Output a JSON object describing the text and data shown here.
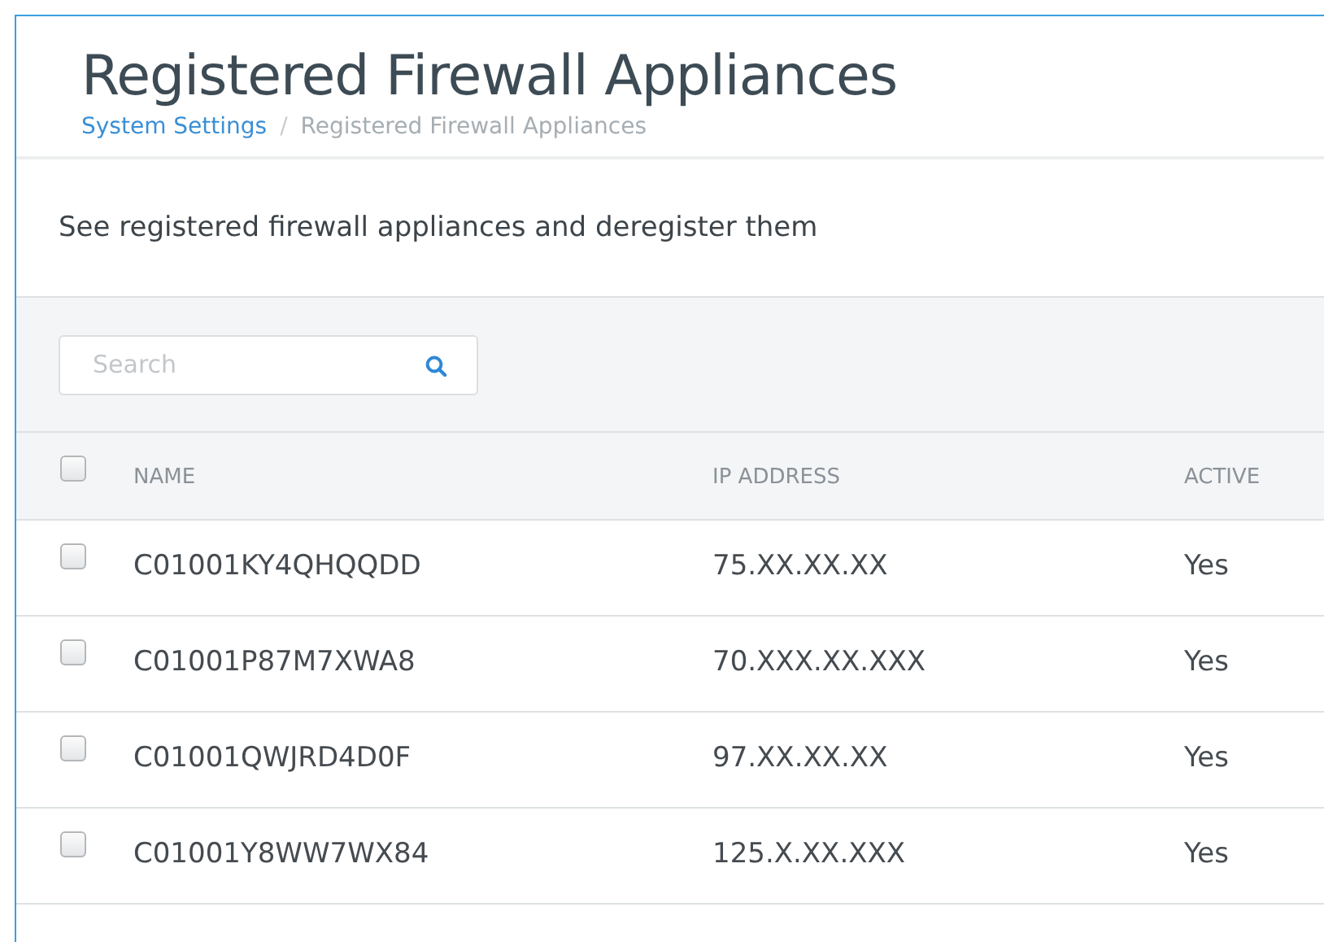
{
  "page": {
    "title": "Registered Firewall Appliances",
    "breadcrumb": [
      {
        "label": "System Settings",
        "link": true
      },
      {
        "label": "Registered Firewall Appliances",
        "link": false
      }
    ],
    "breadcrumb_separator": "/",
    "description": "See registered firewall appliances and deregister them"
  },
  "search": {
    "placeholder": "Search"
  },
  "table": {
    "select_all": {
      "checked": false
    },
    "columns": [
      "NAME",
      "IP ADDRESS",
      "ACTIVE"
    ],
    "rows": [
      {
        "checked": false,
        "cells": [
          "C01001KY4QHQQDD",
          "75.XX.XX.XX",
          "Yes"
        ]
      },
      {
        "checked": false,
        "cells": [
          "C01001P87M7XWA8",
          "70.XXX.XX.XXX",
          "Yes"
        ]
      },
      {
        "checked": false,
        "cells": [
          "C01001QWJRD4D0F",
          "97.XX.XX.XX",
          "Yes"
        ]
      },
      {
        "checked": false,
        "cells": [
          "C01001Y8WW7WX84",
          "125.X.XX.XXX",
          "Yes"
        ]
      }
    ]
  }
}
